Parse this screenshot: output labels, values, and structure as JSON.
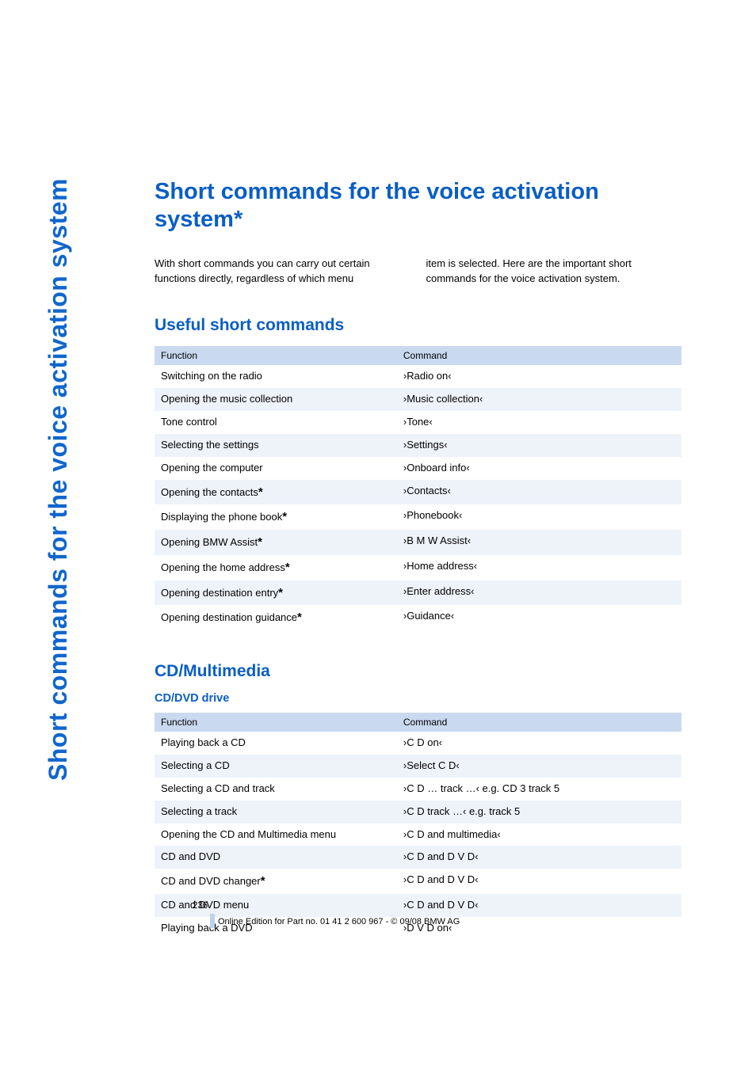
{
  "side_tab": "Short commands for the voice activation system",
  "title": "Short commands for the voice activation system*",
  "intro_left": "With short commands you can carry out certain functions directly, regardless of which menu",
  "intro_right": "item is selected. Here are the important short commands for the voice activation system.",
  "section_useful": "Useful short commands",
  "table1": {
    "head_function": "Function",
    "head_command": "Command",
    "rows": [
      {
        "f": "Switching on the radio",
        "star": false,
        "c": "›Radio on‹"
      },
      {
        "f": "Opening the music collection",
        "star": false,
        "c": "›Music collection‹"
      },
      {
        "f": "Tone control",
        "star": false,
        "c": "›Tone‹"
      },
      {
        "f": "Selecting the settings",
        "star": false,
        "c": "›Settings‹"
      },
      {
        "f": "Opening the computer",
        "star": false,
        "c": "›Onboard info‹"
      },
      {
        "f": "Opening the contacts",
        "star": true,
        "c": "›Contacts‹"
      },
      {
        "f": "Displaying the phone book",
        "star": true,
        "c": "›Phonebook‹"
      },
      {
        "f": "Opening BMW Assist",
        "star": true,
        "c": "›B M W Assist‹"
      },
      {
        "f": "Opening the home address",
        "star": true,
        "c": "›Home address‹"
      },
      {
        "f": "Opening destination entry",
        "star": true,
        "c": "›Enter address‹"
      },
      {
        "f": "Opening destination guidance",
        "star": true,
        "c": "›Guidance‹"
      }
    ]
  },
  "section_cd": "CD/Multimedia",
  "sub_cddvd": "CD/DVD drive",
  "table2": {
    "head_function": "Function",
    "head_command": "Command",
    "rows": [
      {
        "f": "Playing back a CD",
        "star": false,
        "c": "›C D on‹"
      },
      {
        "f": "Selecting a CD",
        "star": false,
        "c": "›Select C D‹"
      },
      {
        "f": "Selecting a CD and track",
        "star": false,
        "c": "›C D … track …‹ e.g. CD 3 track 5"
      },
      {
        "f": "Selecting a track",
        "star": false,
        "c": "›C D track …‹ e.g. track 5"
      },
      {
        "f": "Opening the CD and Multimedia menu",
        "star": false,
        "c": "›C D and multimedia‹"
      },
      {
        "f": "CD and DVD",
        "star": false,
        "c": "›C D and D V D‹"
      },
      {
        "f": "CD and DVD changer",
        "star": true,
        "c": "›C D and D V D‹"
      },
      {
        "f": "CD and DVD menu",
        "star": false,
        "c": "›C D and D V D‹"
      },
      {
        "f": "Playing back a DVD",
        "star": false,
        "c": "›D V D on‹"
      }
    ]
  },
  "page_number": "236",
  "footer_line": "Online Edition for Part no. 01 41 2 600 967  - © 09/08 BMW AG"
}
